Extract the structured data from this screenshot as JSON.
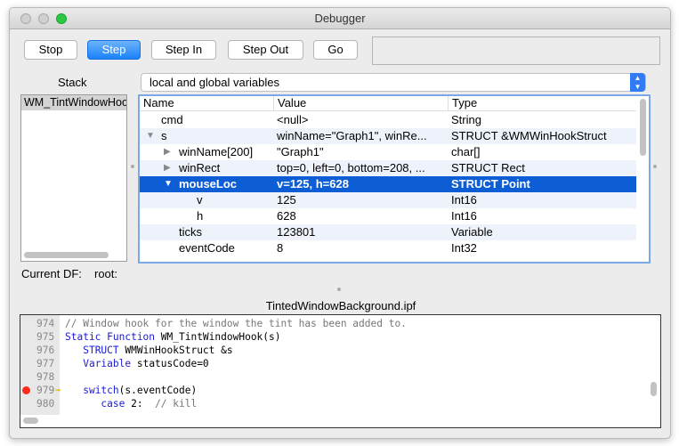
{
  "window": {
    "title": "Debugger"
  },
  "toolbar": {
    "stop": "Stop",
    "step": "Step",
    "step_in": "Step In",
    "step_out": "Step Out",
    "go": "Go"
  },
  "stack": {
    "label": "Stack",
    "items": [
      "WM_TintWindowHook"
    ]
  },
  "scope_select": {
    "value": "local and global variables"
  },
  "variables": {
    "columns": [
      "Name",
      "Value",
      "Type"
    ],
    "rows": [
      {
        "name": "cmd",
        "value": "<null>",
        "type": "String",
        "indent": 0,
        "disclosure": ""
      },
      {
        "name": "s",
        "value": "winName=\"Graph1\", winRe...",
        "type": "STRUCT  &WMWinHookStruct",
        "indent": 0,
        "disclosure": "expanded"
      },
      {
        "name": "winName[200]",
        "value": "\"Graph1\"",
        "type": "char[]",
        "indent": 1,
        "disclosure": "collapsed"
      },
      {
        "name": "winRect",
        "value": "top=0, left=0, bottom=208, ...",
        "type": "STRUCT Rect",
        "indent": 1,
        "disclosure": "collapsed"
      },
      {
        "name": "mouseLoc",
        "value": "v=125, h=628",
        "type": "STRUCT Point",
        "indent": 1,
        "disclosure": "expanded",
        "selected": true
      },
      {
        "name": "v",
        "value": "125",
        "type": "Int16",
        "indent": 2,
        "disclosure": ""
      },
      {
        "name": "h",
        "value": "628",
        "type": "Int16",
        "indent": 2,
        "disclosure": ""
      },
      {
        "name": "ticks",
        "value": "123801",
        "type": "Variable",
        "indent": 1,
        "disclosure": ""
      },
      {
        "name": "eventCode",
        "value": "8",
        "type": "Int32",
        "indent": 1,
        "disclosure": ""
      }
    ]
  },
  "current_df": {
    "label": "Current DF:",
    "value": "root:"
  },
  "source": {
    "filename": "TintedWindowBackground.ipf",
    "lines": [
      {
        "n": "974",
        "html": "<span class='cm'>// Window hook for the window the tint has been added to.</span>"
      },
      {
        "n": "975",
        "html": "<span class='kw'>Static Function</span> WM_TintWindowHook(s)"
      },
      {
        "n": "976",
        "html": "   <span class='kw'>STRUCT</span> WMWinHookStruct &amp;s"
      },
      {
        "n": "977",
        "html": "   <span class='kw'>Variable</span> statusCode=0"
      },
      {
        "n": "978",
        "html": ""
      },
      {
        "n": "979",
        "html": "   <span class='kw'>switch</span>(s.eventCode)",
        "breakpoint": true,
        "current": true
      },
      {
        "n": "980",
        "html": "      <span class='kw'>case</span> 2:  <span class='cm'>// kill</span>"
      }
    ]
  },
  "colors": {
    "accent": "#1a82fb",
    "selection": "#0d5ed5",
    "breakpoint": "#ff2a1a"
  }
}
